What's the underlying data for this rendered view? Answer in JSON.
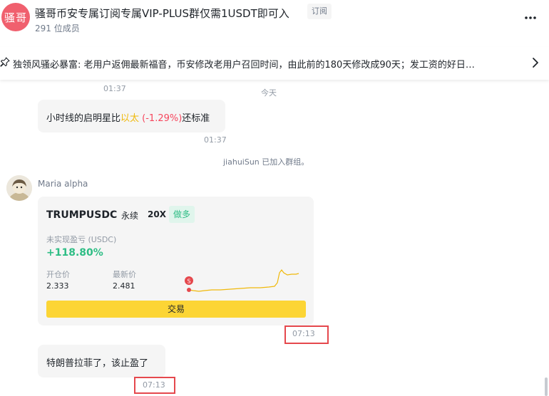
{
  "header": {
    "avatar_text": "骚哥",
    "title": "骚哥币安专属订阅专属VIP-PLUS群仅需1USDT即可入",
    "subscribe_tag": "订阅",
    "member_count": "291 位成员",
    "more_icon": "more-vertical-icon"
  },
  "pinned": {
    "icon": "pin-icon",
    "text": "独领风骚必暴富: 老用户返佣最新福音，币安修改老用户召回时间，由此前的180天修改成90天；发工资的好日…",
    "chevron_icon": "chevron-right-icon"
  },
  "chat": {
    "time_top": "01:37",
    "day_divider": "今天",
    "msg1": {
      "prefix": "小时线的启明星比",
      "highlight": "以太",
      "pct": " (-1.29%)",
      "suffix": "还标准",
      "time": "01:37"
    },
    "system_msg": "jiahuiSun 已加入群组。",
    "sender_name": "Maria alpha",
    "card": {
      "pair": "TRUMPUSDC",
      "contract_type": "永续",
      "leverage": "20X",
      "side": "做多",
      "pnl_label": "未实现盈亏 (USDC)",
      "pnl_value": "+118.80%",
      "open_label": "开仓价",
      "open_value": "2.333",
      "last_label": "最新价",
      "last_value": "2.481",
      "marker_label": "S",
      "trade_button": "交易",
      "time": "07:13"
    },
    "msg2": {
      "text": "特朗普拉菲了，该止盈了",
      "time": "07:13"
    }
  },
  "colors": {
    "accent_yellow": "#fcd535",
    "green": "#2ebd85",
    "red": "#f6465d",
    "avatar_pink": "#f0606e",
    "highlight_red": "#e5484d"
  }
}
